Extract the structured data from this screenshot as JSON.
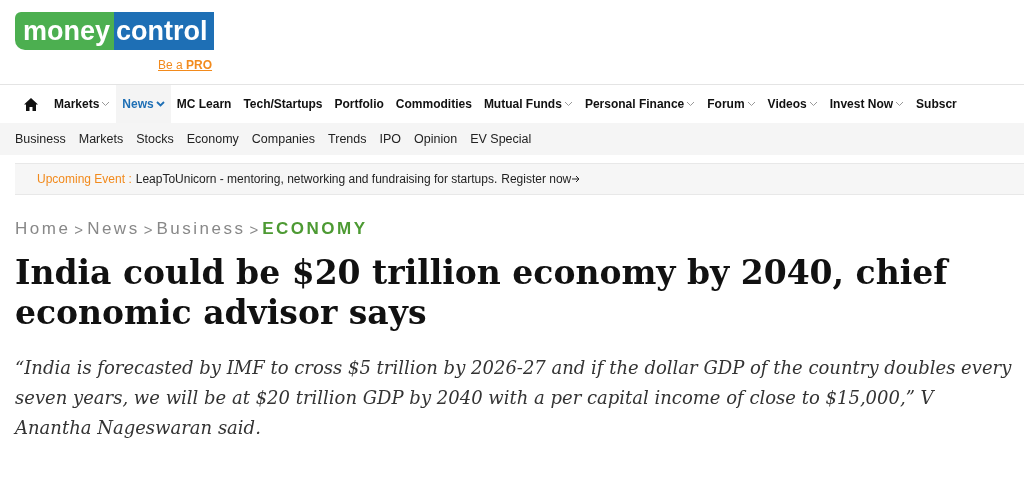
{
  "logo": {
    "part_1": "money",
    "part_2": "control",
    "tagline_prefix": "Be a ",
    "tagline_strong": "PRO"
  },
  "nav": {
    "items": [
      {
        "label": "Markets",
        "has_menu": true,
        "selected": false
      },
      {
        "label": "News",
        "has_menu": true,
        "selected": true
      },
      {
        "label": "MC Learn",
        "has_menu": false,
        "selected": false
      },
      {
        "label": "Tech/Startups",
        "has_menu": false,
        "selected": false
      },
      {
        "label": "Portfolio",
        "has_menu": false,
        "selected": false
      },
      {
        "label": "Commodities",
        "has_menu": false,
        "selected": false
      },
      {
        "label": "Mutual Funds",
        "has_menu": true,
        "selected": false
      },
      {
        "label": "Personal Finance",
        "has_menu": true,
        "selected": false
      },
      {
        "label": "Forum",
        "has_menu": true,
        "selected": false
      },
      {
        "label": "Videos",
        "has_menu": true,
        "selected": false
      },
      {
        "label": "Invest Now",
        "has_menu": true,
        "selected": false
      },
      {
        "label": "Subscr",
        "has_menu": false,
        "selected": false
      }
    ]
  },
  "subnav": [
    "Business",
    "Markets",
    "Stocks",
    "Economy",
    "Companies",
    "Trends",
    "IPO",
    "Opinion",
    "EV Special"
  ],
  "event_bar": {
    "label": "Upcoming Event :",
    "text": "LeapToUnicorn - mentoring, networking and fundraising for startups.",
    "link": "Register now"
  },
  "breadcrumb_separator": ">",
  "breadcrumb": [
    {
      "label": "Home",
      "current": false
    },
    {
      "label": "News",
      "current": false
    },
    {
      "label": "Business",
      "current": false
    },
    {
      "label": "ECONOMY",
      "current": true
    }
  ],
  "headline": "India could be $20 trillion economy by 2040, chief economic advisor says",
  "summary": "“India is forecasted by IMF to cross $5 trillion by 2026-27 and if the dollar GDP of the country doubles every seven years, we will be at $20 trillion GDP by 2040 with a per capital income of close to $15,000,” V Anantha Nageswaran said."
}
